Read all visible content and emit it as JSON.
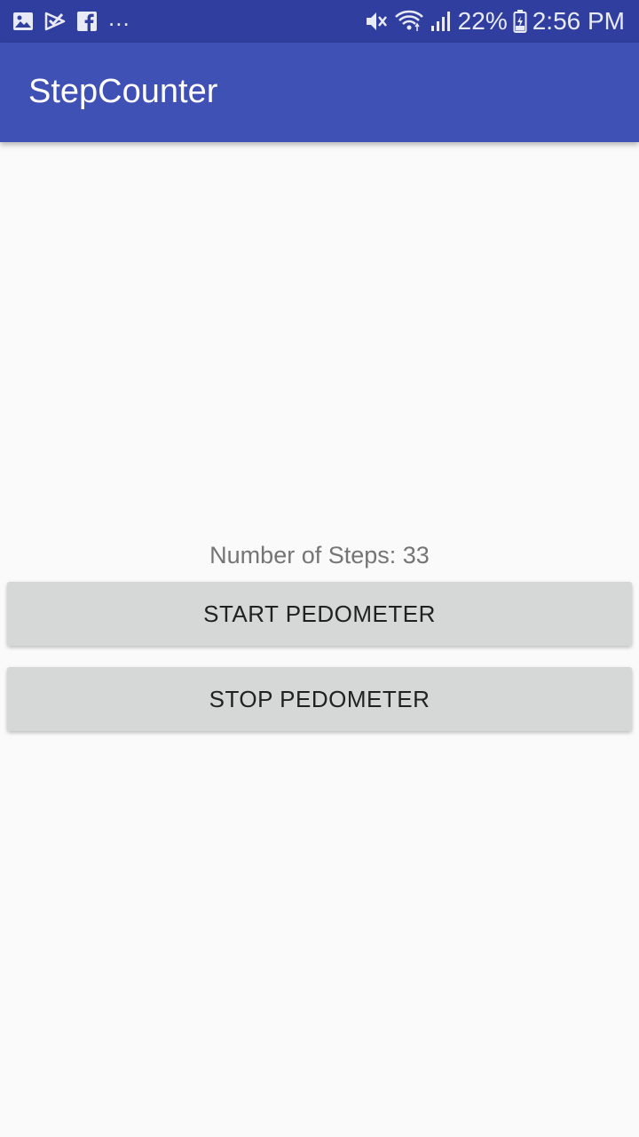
{
  "status_bar": {
    "notification_icons": [
      "image-icon",
      "check-icon",
      "facebook-icon"
    ],
    "overflow": "...",
    "system_icons": [
      "mute-icon",
      "wifi-icon",
      "signal-icon"
    ],
    "battery_percent": "22%",
    "time": "2:56 PM"
  },
  "app_bar": {
    "title": "StepCounter"
  },
  "main": {
    "steps_label": "Number of Steps: 33",
    "start_button_label": "START PEDOMETER",
    "stop_button_label": "STOP PEDOMETER"
  },
  "colors": {
    "status_bar": "#303f9f",
    "app_bar": "#3f51b5",
    "background": "#fafafa",
    "button": "#d6d7d7"
  }
}
